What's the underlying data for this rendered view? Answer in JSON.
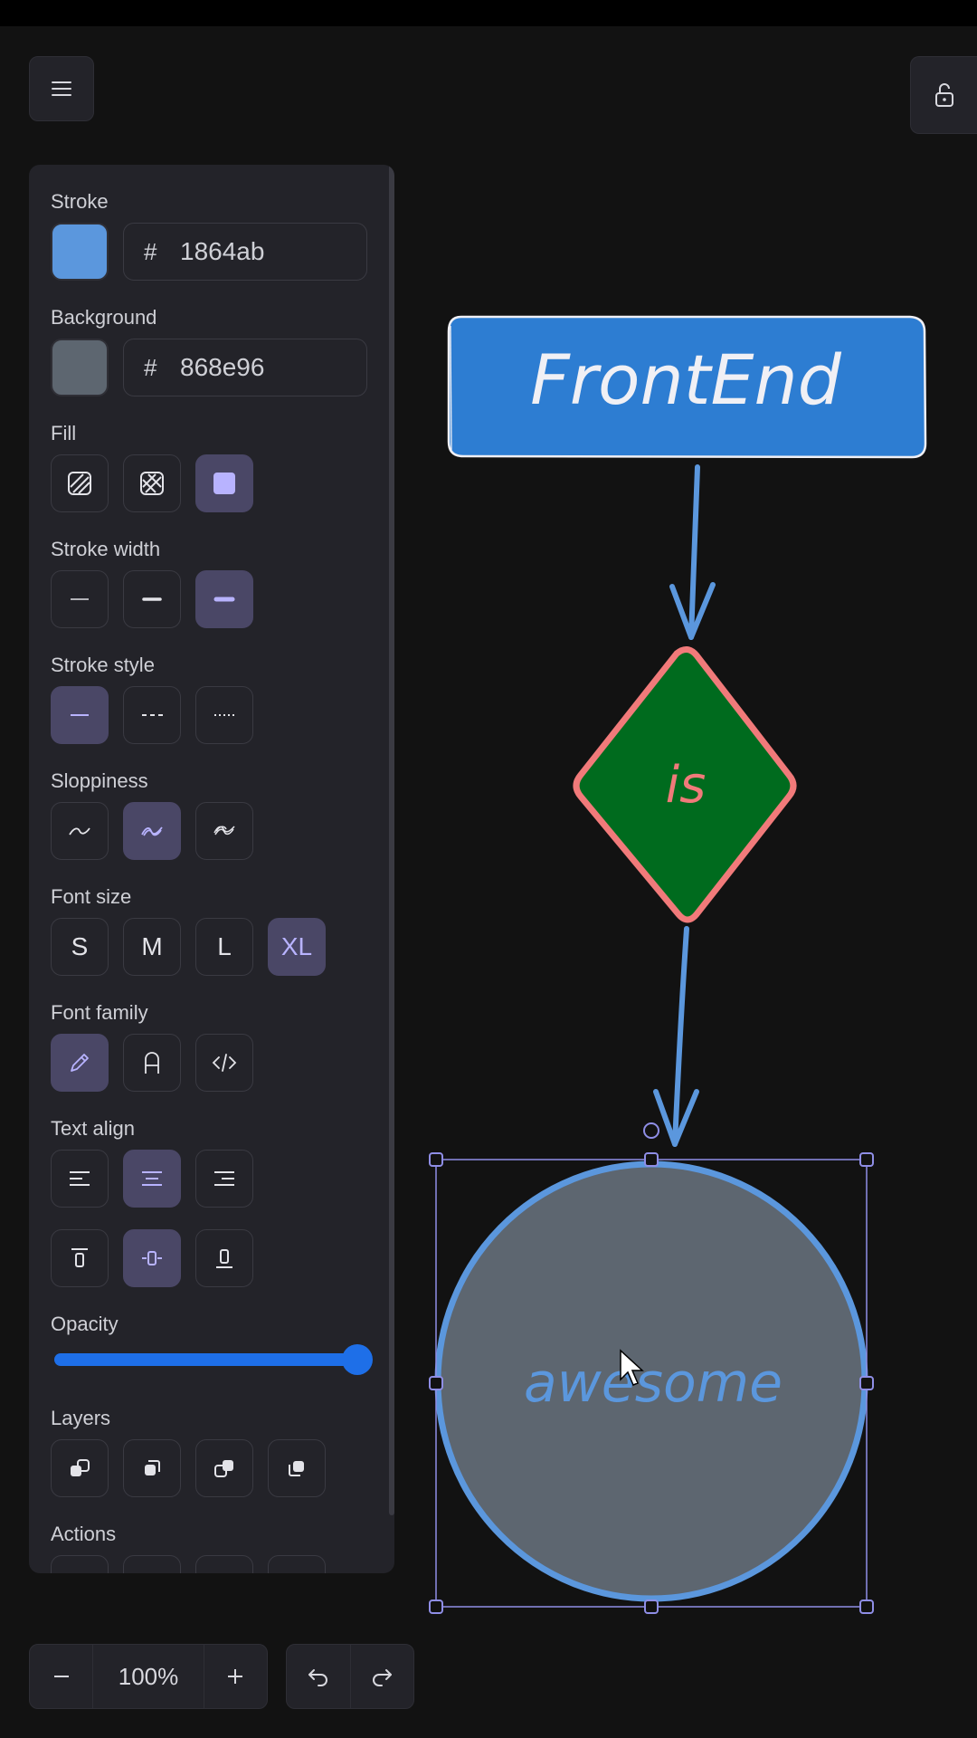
{
  "panel": {
    "stroke": {
      "label": "Stroke",
      "color": "#5b97dd",
      "hex": "1864ab",
      "hash": "#"
    },
    "background": {
      "label": "Background",
      "color": "#5d6670",
      "hex": "868e96",
      "hash": "#"
    },
    "fill": {
      "label": "Fill",
      "options": [
        "hachure-icon",
        "cross-hatch-icon",
        "solid-icon"
      ],
      "active": 2
    },
    "stroke_width": {
      "label": "Stroke width",
      "options": [
        "thin-line-icon",
        "bold-line-icon",
        "extra-bold-line-icon"
      ],
      "active": 2
    },
    "stroke_style": {
      "label": "Stroke style",
      "options": [
        "solid-line-icon",
        "dashed-line-icon",
        "dotted-line-icon"
      ],
      "active": 0
    },
    "sloppiness": {
      "label": "Sloppiness",
      "options": [
        "architect-icon",
        "artist-icon",
        "cartoonist-icon"
      ],
      "active": 1
    },
    "font_size": {
      "label": "Font size",
      "options": [
        "S",
        "M",
        "L",
        "XL"
      ],
      "active": 3
    },
    "font_family": {
      "label": "Font family",
      "options": [
        "pencil-icon",
        "normal-font-icon",
        "code-icon"
      ],
      "active": 0
    },
    "text_align": {
      "label": "Text align",
      "active_h": 1,
      "active_v": 1
    },
    "opacity": {
      "label": "Opacity",
      "value": 100
    },
    "layers": {
      "label": "Layers"
    },
    "actions": {
      "label": "Actions"
    }
  },
  "zoom": {
    "value": "100%"
  },
  "canvas": {
    "rect_label": "FrontEnd",
    "diamond_label": "is",
    "ellipse_label": "awesome",
    "colors": {
      "rect_fill": "#2d7dd2",
      "diamond_fill": "#006b1e",
      "diamond_stroke": "#f17a7a",
      "arrow": "#5b97dd",
      "ellipse_fill": "#5d6670",
      "selection": "#8f8ee6"
    }
  }
}
